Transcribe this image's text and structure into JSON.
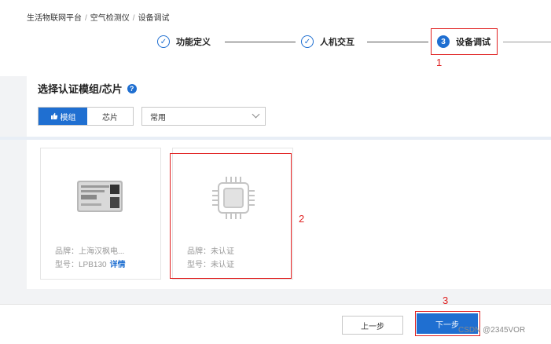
{
  "breadcrumb": [
    "生活物联网平台",
    "空气检测仪",
    "设备调试"
  ],
  "breadcrumb_sep": "/",
  "steps": [
    {
      "num": "✓",
      "label": "功能定义",
      "state": "done"
    },
    {
      "num": "✓",
      "label": "人机交互",
      "state": "done"
    },
    {
      "num": "3",
      "label": "设备调试",
      "state": "active"
    }
  ],
  "annotations": [
    "1",
    "2",
    "3"
  ],
  "section": {
    "title": "选择认证模组/芯片",
    "help": "?"
  },
  "tabs": {
    "active": "模组",
    "inactive": "芯片"
  },
  "select": {
    "value": "常用"
  },
  "modules": [
    {
      "brand_label": "品牌：",
      "brand": "上海汉枫电...",
      "model_label": "型号：",
      "model": "LPB130",
      "link": "详情"
    },
    {
      "brand_label": "品牌：",
      "brand": "未认证",
      "model_label": "型号：",
      "model": "未认证"
    }
  ],
  "footer": {
    "prev": "上一步",
    "next": "下一步"
  },
  "watermark": "CSDN @2345VOR",
  "colors": {
    "primary": "#1f6fd1",
    "annotation": "#e02020"
  }
}
